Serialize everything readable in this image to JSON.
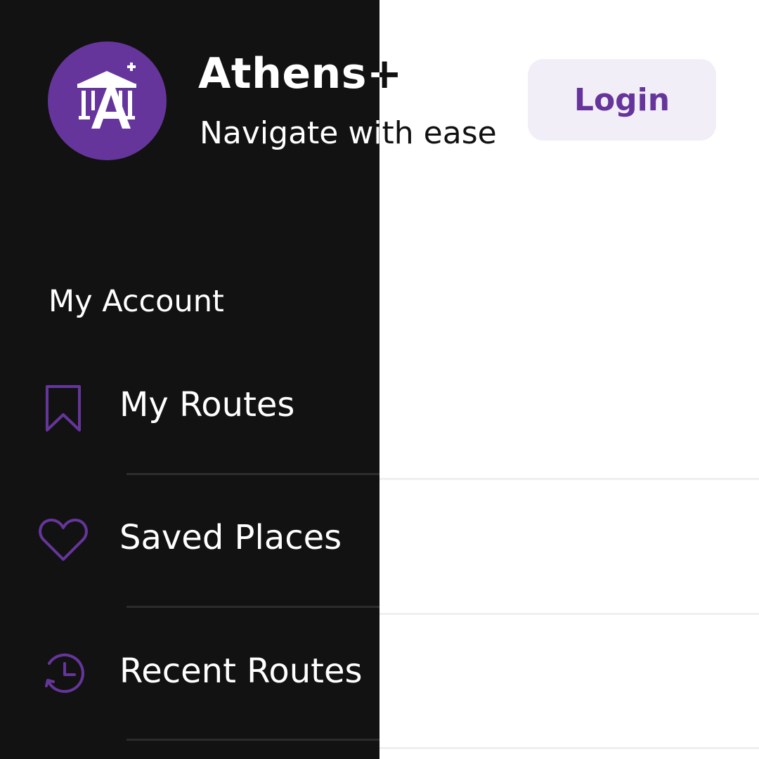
{
  "app": {
    "title": "Athens+",
    "subtitle": "Navigate with ease",
    "logo_icon": "temple-columns-icon"
  },
  "header": {
    "login_label": "Login"
  },
  "sidebar": {
    "section_label": "My Account",
    "items": [
      {
        "label": "My Routes",
        "icon": "bookmark-icon"
      },
      {
        "label": "Saved Places",
        "icon": "heart-icon"
      },
      {
        "label": "Recent Routes",
        "icon": "history-clock-icon"
      }
    ]
  },
  "colors": {
    "brand": "#66359c",
    "panel_dark": "#121212",
    "login_bg": "#f2eef7"
  }
}
